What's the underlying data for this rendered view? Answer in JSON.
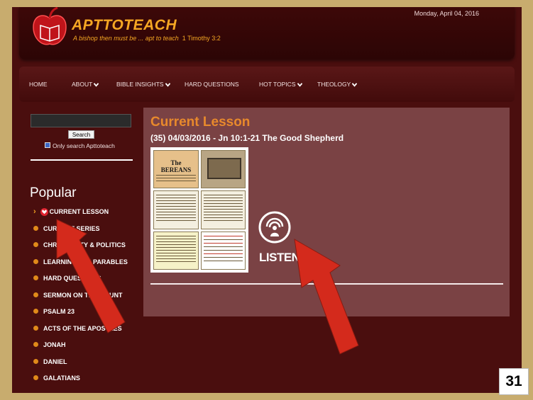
{
  "header": {
    "brand": "APTTOTEACH",
    "tagline": "A bishop then must be ... apt to teach",
    "tagline_ref": "1 Timothy 3:2",
    "date": "Monday, April 04, 2016"
  },
  "nav": {
    "items": [
      {
        "label": "HOME"
      },
      {
        "label": "ABOUT"
      },
      {
        "label": "BIBLE INSIGHTS"
      },
      {
        "label": "HARD QUESTIONS"
      },
      {
        "label": "HOT TOPICS"
      },
      {
        "label": "THEOLOGY"
      }
    ]
  },
  "sidebar": {
    "search_button": "Search",
    "only_search": "Only search Apttoteach",
    "popular_title": "Popular",
    "popular_items": [
      {
        "label": "CURRENT LESSON"
      },
      {
        "label": "CURRENT SERIES"
      },
      {
        "label": "CHRISTIANITY & POLITICS"
      },
      {
        "label": "LEARNING THE PARABLES"
      },
      {
        "label": "HARD QUESTIONS"
      },
      {
        "label": "SERMON ON THE MOUNT"
      },
      {
        "label": "PSALM 23"
      },
      {
        "label": "ACTS OF THE APOSTLES"
      },
      {
        "label": "JONAH"
      },
      {
        "label": "DANIEL"
      },
      {
        "label": "GALATIANS"
      }
    ]
  },
  "main": {
    "heading": "Current Lesson",
    "lesson_title": "(35) 04/03/2016 - Jn 10:1-21 The Good Shepherd",
    "thumbnail_title": "The BEREANS",
    "listen_label": "LISTEN"
  },
  "slide_number": "31",
  "colors": {
    "accent": "#f6a723",
    "frame_bg": "#4a0e0e",
    "panel_bg": "#7a4244",
    "arrow": "#d42a1c"
  }
}
